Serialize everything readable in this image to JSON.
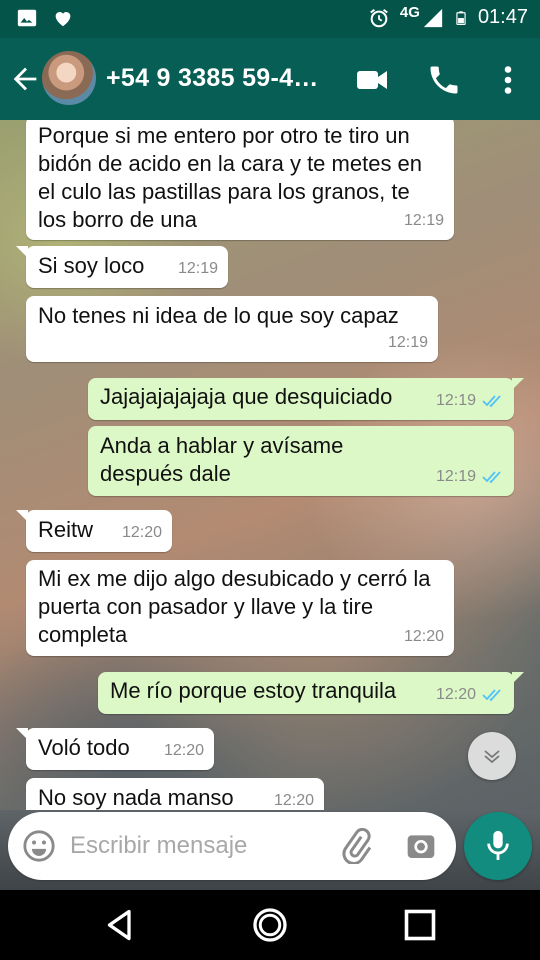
{
  "status_bar": {
    "network": "4G",
    "time": "01:47",
    "icons": [
      "image-icon",
      "heart-icon",
      "alarm-icon",
      "signal-icon",
      "battery-icon"
    ]
  },
  "header": {
    "contact": "+54 9 3385 59-4…",
    "icons": [
      "back-arrow-icon",
      "video-call-icon",
      "phone-icon",
      "more-vert-icon"
    ]
  },
  "messages": [
    {
      "dir": "in",
      "text": "Porque si me entero por otro te tiro un bidón de acido en la cara y te metes en el culo las pastillas para los granos, te los borro de una",
      "time": "12:19"
    },
    {
      "dir": "in",
      "text": "Si soy loco",
      "time": "12:19"
    },
    {
      "dir": "in",
      "text": "No tenes ni idea de lo que soy capaz",
      "time": "12:19"
    },
    {
      "dir": "out",
      "text": "Jajajajajajaja que desquiciado",
      "time": "12:19",
      "status": "read"
    },
    {
      "dir": "out",
      "text": "Anda a hablar y avísame después dale",
      "time": "12:19",
      "status": "read"
    },
    {
      "dir": "in",
      "text": "Reitw",
      "time": "12:20"
    },
    {
      "dir": "in",
      "text": "Mi ex me dijo algo desubicado y cerró la puerta con pasador y llave y la tire completa",
      "time": "12:20"
    },
    {
      "dir": "out",
      "text": "Me río porque estoy tranquila",
      "time": "12:20",
      "status": "read"
    },
    {
      "dir": "in",
      "text": "Voló todo",
      "time": "12:20"
    },
    {
      "dir": "in",
      "text": "No soy nada manso",
      "time": "12:20"
    }
  ],
  "composer": {
    "placeholder": "Escribir mensaje",
    "icons": [
      "emoji-icon",
      "attach-icon",
      "camera-icon",
      "mic-icon"
    ]
  },
  "colors": {
    "status_bar": "#04544a",
    "app_bar": "#075e54",
    "bubble_in": "#ffffff",
    "bubble_out": "#dcf8c6",
    "read_ticks": "#4fc3f7",
    "mic_button": "#128c7e"
  },
  "nav": {
    "icons": [
      "back-triangle-icon",
      "home-circle-icon",
      "recents-square-icon"
    ]
  }
}
